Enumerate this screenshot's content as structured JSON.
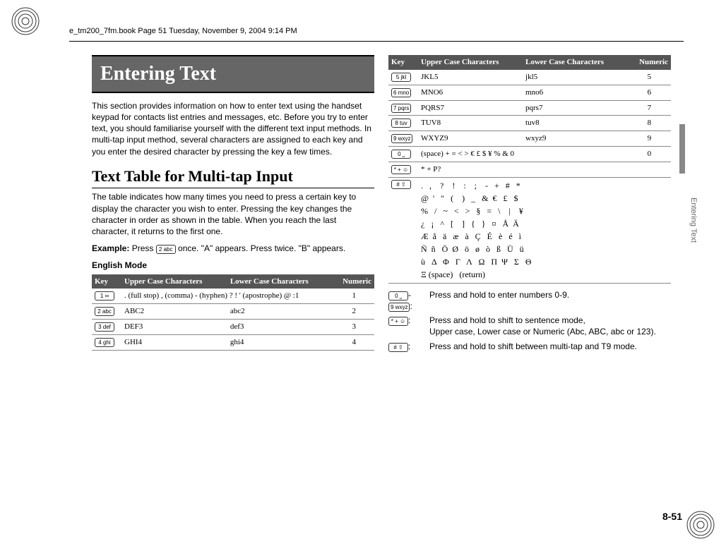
{
  "header_line": "e_tm200_7fm.book  Page 51  Tuesday, November 9, 2004  9:14 PM",
  "title": "Entering Text",
  "intro": "This section provides information on how to enter text using the handset keypad for contacts list entries and messages, etc. Before you try to enter text, you should familiarise yourself with the different text input methods. In multi-tap input method, several characters are assigned to each key and you enter the desired character by pressing the key a few times.",
  "h2": "Text Table for Multi-tap Input",
  "para2": "The table indicates how many times you need to press a certain key to display the character you wish to enter. Pressing the key changes the character in order as shown in the table. When you reach the last character, it returns to the first one.",
  "example_label": "Example:",
  "example_text": " Press ",
  "example_key": "2 abc",
  "example_tail": " once. \"A\" appears. Press twice. \"B\" appears.",
  "mode_label": "English Mode",
  "table_headers": {
    "key": "Key",
    "upper": "Upper Case Characters",
    "lower": "Lower Case Characters",
    "numeric": "Numeric"
  },
  "rows_left": [
    {
      "key": "1 ∞",
      "upper": ". (full stop) , (comma) - (hyphen) ? ! ' (apostrophe) @ :1",
      "lower": "",
      "numeric": "1"
    },
    {
      "key": "2 abc",
      "upper": "ABC2",
      "lower": "abc2",
      "numeric": "2"
    },
    {
      "key": "3 def",
      "upper": "DEF3",
      "lower": "def3",
      "numeric": "3"
    },
    {
      "key": "4 ghi",
      "upper": "GHI4",
      "lower": "ghi4",
      "numeric": "4"
    }
  ],
  "rows_right": [
    {
      "key": "5 jkl",
      "upper": "JKL5",
      "lower": "jkl5",
      "numeric": "5"
    },
    {
      "key": "6 mno",
      "upper": "MNO6",
      "lower": "mno6",
      "numeric": "6"
    },
    {
      "key": "7 pqrs",
      "upper": "PQRS7",
      "lower": "pqrs7",
      "numeric": "7"
    },
    {
      "key": "8 tuv",
      "upper": "TUV8",
      "lower": "tuv8",
      "numeric": "8"
    },
    {
      "key": "9 wxyz",
      "upper": "WXYZ9",
      "lower": "wxyz9",
      "numeric": "9"
    },
    {
      "key": "0 ⎵",
      "upper": "(space) + = < > € £ $ ¥ % & 0",
      "lower": "",
      "numeric": "0"
    },
    {
      "key": "* + ☺",
      "upper": "* + P?",
      "lower": "",
      "numeric": ""
    }
  ],
  "hash_key": "# ⇧",
  "sym_lines": [
    ".   ,    ?    !    :    ;    -   +   #   *",
    "@  '   \"   (    )   _   &  €   £   $",
    "%   /   ~   <   >   §   =   \\    |    ¥",
    "¿   ¡   ^   [    ]   {   }   ¤   Å  Ä",
    "Æ  å   ä   æ   à   Ç   É   è   é   ì",
    "Ñ  ñ   Ö  Ø   ö   ø   ò   ß   Ü   ü",
    "ù   Δ   Φ   Γ   Λ   Ω   Π  Ψ   Σ   Θ",
    "Ξ (space)   (return)"
  ],
  "notes": {
    "n1_key_a": "0 ⎵",
    "n1_sep": "-",
    "n1_key_b": "9 wxyz",
    "n1_text": "Press and hold to enter numbers 0-9.",
    "n2_key": "* + ☺",
    "n2_text_a": "Press and hold to shift to sentence mode,",
    "n2_text_b": "Upper case, Lower case or Numeric (Abc, ABC, abc or 123).",
    "n3_key": "# ⇧",
    "n3_text": "Press and hold to shift between multi-tap and T9 mode."
  },
  "side_label": "Entering Text",
  "page_number": "8-51"
}
